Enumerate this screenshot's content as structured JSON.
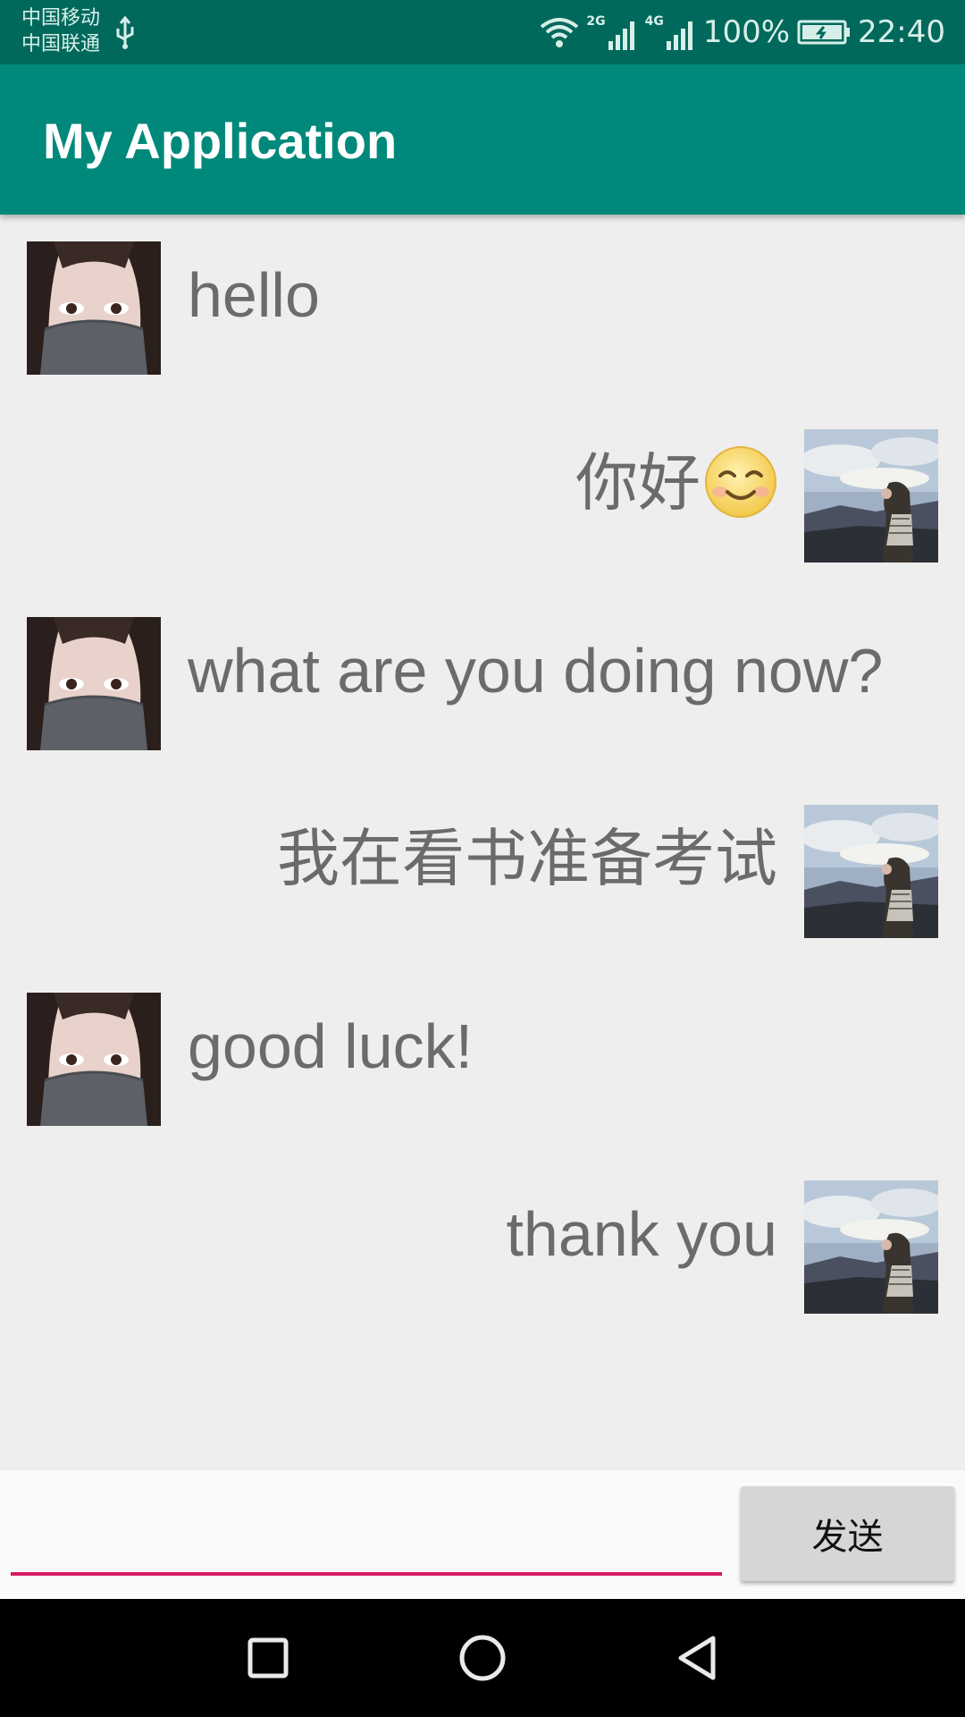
{
  "status_bar": {
    "carrier_1": "中国移动",
    "carrier_2": "中国联通",
    "net_1": "2G",
    "net_2": "4G",
    "battery": "100%",
    "time": "22:40",
    "icons": [
      "usb-icon",
      "wifi-icon",
      "signal-icon",
      "battery-icon"
    ]
  },
  "toolbar": {
    "title": "My Application"
  },
  "messages": [
    {
      "side": "left",
      "text": "hello",
      "avatar": "masked-girl-avatar"
    },
    {
      "side": "right",
      "text": "你好",
      "emoji": "smile-emoji",
      "avatar": "landscape-girl-avatar"
    },
    {
      "side": "left",
      "text": "what are you doing now?",
      "avatar": "masked-girl-avatar"
    },
    {
      "side": "right",
      "text": "我在看书准备考试",
      "avatar": "landscape-girl-avatar"
    },
    {
      "side": "left",
      "text": "good luck!",
      "avatar": "masked-girl-avatar"
    },
    {
      "side": "right",
      "text": "thank you",
      "avatar": "landscape-girl-avatar"
    }
  ],
  "input": {
    "value": "",
    "placeholder": ""
  },
  "send_button": {
    "label": "发送"
  },
  "nav_bar": {
    "icons": [
      "recent-apps-icon",
      "home-icon",
      "back-icon"
    ]
  },
  "colors": {
    "status_bar": "#00695c",
    "toolbar": "#00897b",
    "accent": "#d81b60",
    "background": "#eeeeee",
    "message_text": "#6b6b6b"
  }
}
